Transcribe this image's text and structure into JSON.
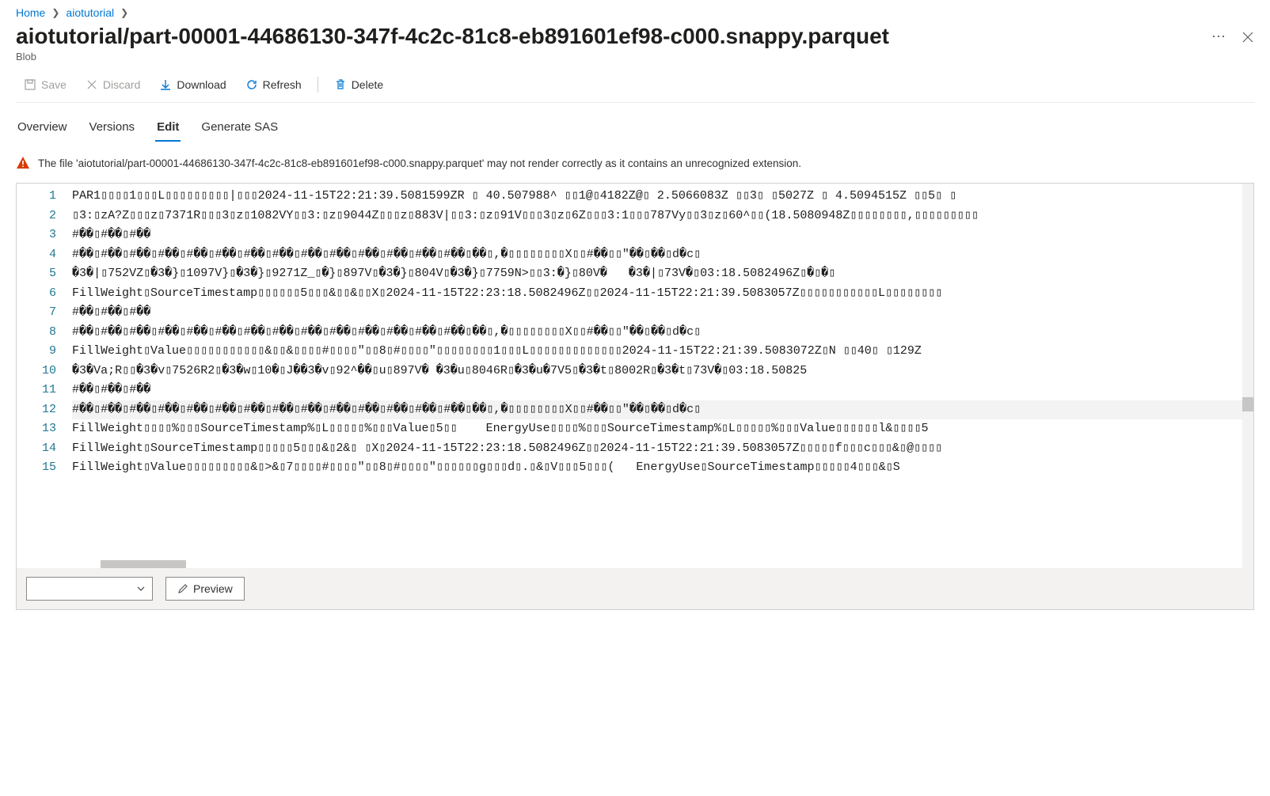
{
  "breadcrumb": {
    "items": [
      "Home",
      "aiotutorial"
    ]
  },
  "header": {
    "title": "aiotutorial/part-00001-44686130-347f-4c2c-81c8-eb891601ef98-c000.snappy.parquet",
    "subtitle": "Blob"
  },
  "toolbar": {
    "save": "Save",
    "discard": "Discard",
    "download": "Download",
    "refresh": "Refresh",
    "delete": "Delete"
  },
  "tabs": {
    "overview": "Overview",
    "versions": "Versions",
    "edit": "Edit",
    "generate_sas": "Generate SAS"
  },
  "warning": {
    "text": "The file 'aiotutorial/part-00001-44686130-347f-4c2c-81c8-eb891601ef98-c000.snappy.parquet' may not render correctly as it contains an unrecognized extension."
  },
  "editor": {
    "line_numbers": [
      "1",
      "2",
      "3",
      "4",
      "5",
      "6",
      "7",
      "8",
      "9",
      "10",
      "11",
      "12",
      "13",
      "14",
      "15"
    ],
    "lines": [
      "PAR1▯▯▯▯1▯▯▯L▯▯▯▯▯▯▯▯▯|▯▯▯2024-11-15T22:21:39.5081599ZR ▯ 40.507988^ ▯▯1@▯4182Z@▯ 2.5066083Z ▯▯3▯ ▯5027Z ▯ 4.5094515Z ▯▯5▯ ▯",
      "▯3:▯zA?Z▯▯▯z▯7371R▯▯▯3▯z▯1082VY▯▯3:▯z▯9044Z▯▯▯z▯883V|▯▯3:▯z▯91V▯▯▯3▯z▯6Z▯▯▯3:1▯▯▯787Vy▯▯3▯z▯60^▯▯(18.5080948Z▯▯▯▯▯▯▯▯,▯▯▯▯▯▯▯▯▯",
      "#��▯#��▯#��",
      "#��▯#��▯#��▯#��▯#��▯#��▯#��▯#��▯#��▯#��▯#��▯#��▯#��▯#��▯��▯,�▯▯▯▯▯▯▯▯X▯▯#��▯▯\"��▯��▯d�c▯",
      "�3�|▯752VZ▯�3�}▯1097V}▯�3�}▯9271Z_▯�}▯897V▯�3�}▯804V▯�3�}▯7759N>▯▯3:�}▯80V�   �3�|▯73V�▯03:18.5082496Z▯�▯�▯",
      "FillWeight▯SourceTimestamp▯▯▯▯▯▯5▯▯▯&▯▯&▯▯X▯2024-11-15T22:23:18.5082496Z▯▯2024-11-15T22:21:39.5083057Z▯▯▯▯▯▯▯▯▯▯▯L▯▯▯▯▯▯▯▯",
      "#��▯#��▯#��",
      "#��▯#��▯#��▯#��▯#��▯#��▯#��▯#��▯#��▯#��▯#��▯#��▯#��▯#��▯��▯,�▯▯▯▯▯▯▯▯X▯▯#��▯▯\"��▯��▯d�c▯",
      "FillWeight▯Value▯▯▯▯▯▯▯▯▯▯▯&▯▯&▯▯▯▯#▯▯▯▯\"▯▯8▯#▯▯▯▯\"▯▯▯▯▯▯▯▯1▯▯▯L▯▯▯▯▯▯▯▯▯▯▯▯▯2024-11-15T22:21:39.5083072Z▯N ▯▯40▯ ▯129Z",
      "�3�Va;R▯▯�3�v▯7526R2▯�3�w▯10�▯J��3�v▯92^��▯u▯897V� �3�u▯8046R▯�3�u�7V5▯�3�t▯8002R▯�3�t▯73V�▯03:18.50825",
      "#��▯#��▯#��",
      "#��▯#��▯#��▯#��▯#��▯#��▯#��▯#��▯#��▯#��▯#��▯#��▯#��▯#��▯��▯,�▯▯▯▯▯▯▯▯X▯▯#��▯▯\"��▯��▯d�c▯",
      "FillWeight▯▯▯▯%▯▯▯SourceTimestamp%▯L▯▯▯▯▯%▯▯▯Value▯5▯▯    EnergyUse▯▯▯▯%▯▯▯SourceTimestamp%▯L▯▯▯▯▯%▯▯▯Value▯▯▯▯▯▯l&▯▯▯▯5",
      "FillWeight▯SourceTimestamp▯▯▯▯▯5▯▯▯&▯2&▯ ▯X▯2024-11-15T22:23:18.5082496Z▯▯2024-11-15T22:21:39.5083057Z▯▯▯▯▯f▯▯▯c▯▯▯&▯@▯▯▯▯",
      "FillWeight▯Value▯▯▯▯▯▯▯▯▯&▯>&▯7▯▯▯▯#▯▯▯▯\"▯▯8▯#▯▯▯▯\"▯▯▯▯▯▯g▯▯▯d▯.▯&▯V▯▯▯5▯▯▯(   EnergyUse▯SourceTimestamp▯▯▯▯▯4▯▯▯&▯S"
    ],
    "highlight_line_index": 11,
    "preview_label": "Preview"
  }
}
